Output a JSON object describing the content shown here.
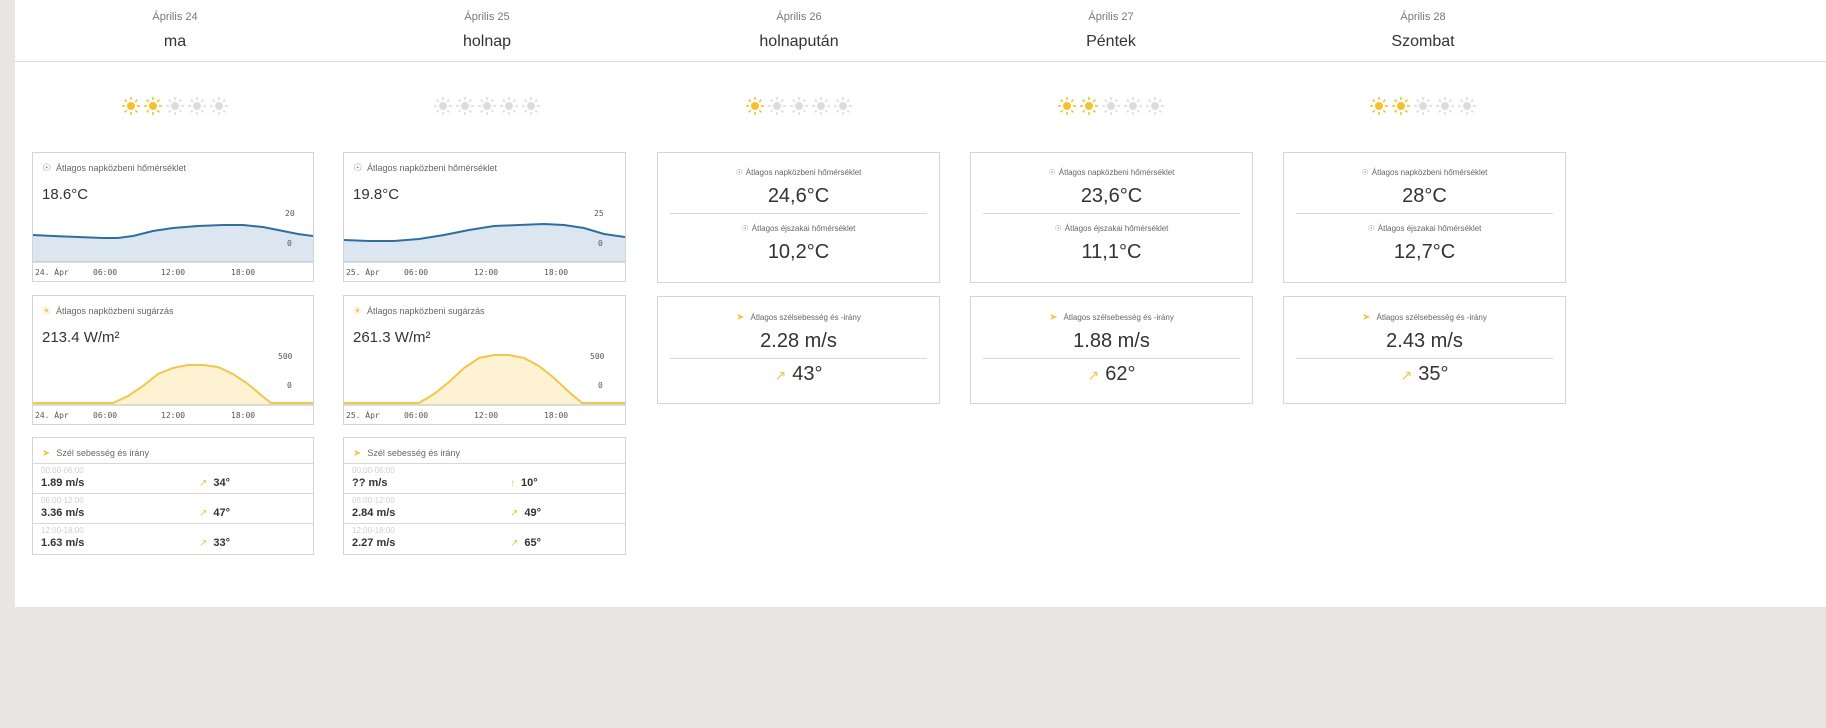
{
  "days": [
    {
      "date": "Április 24",
      "name": "ma",
      "sun_rating": 2
    },
    {
      "date": "Április 25",
      "name": "holnap",
      "sun_rating": 0
    },
    {
      "date": "Április 26",
      "name": "holnapután",
      "sun_rating": 1
    },
    {
      "date": "Április 27",
      "name": "Péntek",
      "sun_rating": 2
    },
    {
      "date": "Április 28",
      "name": "Szombat",
      "sun_rating": 2
    }
  ],
  "sun_rating_max": 5,
  "colors": {
    "sun_on": "#f2c230",
    "sun_off": "#dcdcdc",
    "temp_line": "#2f6f9f",
    "temp_fill": "#dbe6f1",
    "rad_line": "#f1c64a",
    "rad_fill": "#fdf3d2",
    "arrow": "#f1c64a"
  },
  "detail": [
    {
      "temp": {
        "label": "Átlagos napközbeni hőmérséklet",
        "value": "18.6°C",
        "y_ticks": [
          "20",
          "0"
        ],
        "x_ticks": [
          "24. Ápr",
          "06:00",
          "12:00",
          "18:00"
        ]
      },
      "radiation": {
        "label": "Átlagos napközbeni sugárzás",
        "value": "213.4 W/m²",
        "y_ticks": [
          "500",
          "0"
        ],
        "x_ticks": [
          "24. Ápr",
          "06:00",
          "12:00",
          "18:00"
        ]
      },
      "wind": {
        "label": "Szél sebesség és irány",
        "rows": [
          {
            "time": "00:00-06:00",
            "speed": "1.89 m/s",
            "dir": "34°"
          },
          {
            "time": "06:00-12:00",
            "speed": "3.36 m/s",
            "dir": "47°"
          },
          {
            "time": "12:00-18:00",
            "speed": "1.63 m/s",
            "dir": "33°"
          }
        ]
      }
    },
    {
      "temp": {
        "label": "Átlagos napközbeni hőmérséklet",
        "value": "19.8°C",
        "y_ticks": [
          "25",
          "0"
        ],
        "x_ticks": [
          "25. Ápr",
          "06:00",
          "12:00",
          "18:00"
        ]
      },
      "radiation": {
        "label": "Átlagos napközbeni sugárzás",
        "value": "261.3 W/m²",
        "y_ticks": [
          "500",
          "0"
        ],
        "x_ticks": [
          "25. Ápr",
          "06:00",
          "12:00",
          "18:00"
        ]
      },
      "wind": {
        "label": "Szél sebesség és irány",
        "rows": [
          {
            "time": "00:00-06:00",
            "speed": "?? m/s",
            "dir": "10°"
          },
          {
            "time": "06:00-12:00",
            "speed": "2.84 m/s",
            "dir": "49°"
          },
          {
            "time": "12:00-18:00",
            "speed": "2.27 m/s",
            "dir": "65°"
          }
        ]
      }
    }
  ],
  "summary": [
    {
      "day_label": "Átlagos napközbeni hőmérséklet",
      "day_value": "24,6°C",
      "night_label": "Átlagos éjszakai hőmérséklet",
      "night_value": "10,2°C",
      "wind_label": "Átlagos szélsebesség és -irány",
      "wind_speed": "2.28 m/s",
      "wind_dir": "43°"
    },
    {
      "day_label": "Átlagos napközbeni hőmérséklet",
      "day_value": "23,6°C",
      "night_label": "Átlagos éjszakai hőmérséklet",
      "night_value": "11,1°C",
      "wind_label": "Átlagos szélsebesség és -irány",
      "wind_speed": "1.88 m/s",
      "wind_dir": "62°"
    },
    {
      "day_label": "Átlagos napközbeni hőmérséklet",
      "day_value": "28°C",
      "night_label": "Átlagos éjszakai hőmérséklet",
      "night_value": "12,7°C",
      "wind_label": "Átlagos szélsebesség és -irány",
      "wind_speed": "2.43 m/s",
      "wind_dir": "35°"
    }
  ]
}
